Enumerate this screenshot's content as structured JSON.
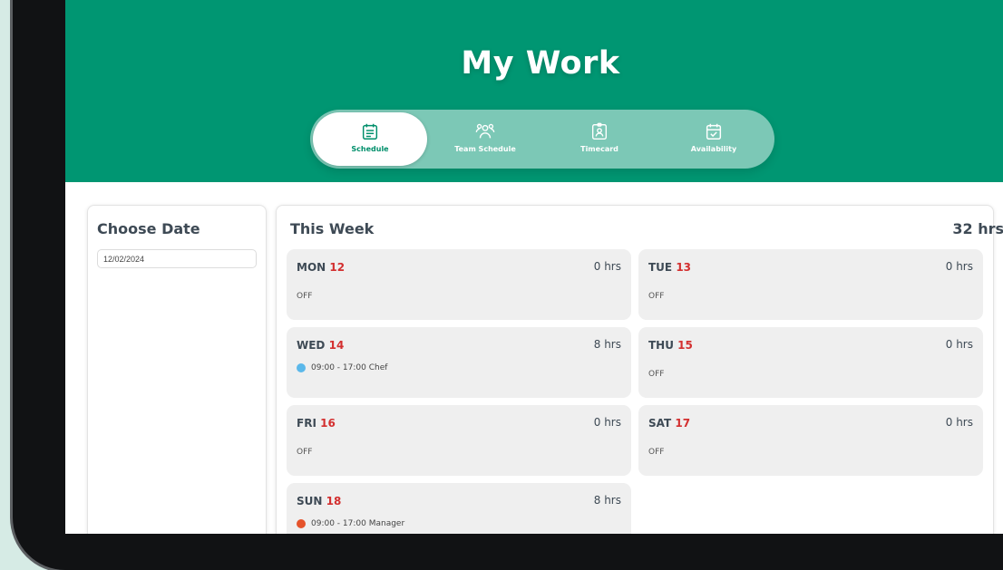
{
  "header": {
    "title": "My Work",
    "color": "#009672",
    "tabs": [
      {
        "label": "Schedule",
        "icon": "calendar-icon",
        "active": true
      },
      {
        "label": "Team Schedule",
        "icon": "team-icon",
        "active": false
      },
      {
        "label": "Timecard",
        "icon": "badge-icon",
        "active": false
      },
      {
        "label": "Availability",
        "icon": "calendar-check-icon",
        "active": false
      }
    ]
  },
  "date_picker": {
    "title": "Choose Date",
    "value": "12/02/2024"
  },
  "week": {
    "title": "This Week",
    "total": "32 hrs",
    "days": [
      {
        "name": "MON",
        "num": "12",
        "hours": "0 hrs",
        "status": "OFF"
      },
      {
        "name": "TUE",
        "num": "13",
        "hours": "0 hrs",
        "status": "OFF"
      },
      {
        "name": "WED",
        "num": "14",
        "hours": "8 hrs",
        "shift": "09:00 - 17:00 Chef",
        "shift_color": "#5bb8ea"
      },
      {
        "name": "THU",
        "num": "15",
        "hours": "0 hrs",
        "status": "OFF"
      },
      {
        "name": "FRI",
        "num": "16",
        "hours": "0 hrs",
        "status": "OFF"
      },
      {
        "name": "SAT",
        "num": "17",
        "hours": "0 hrs",
        "status": "OFF"
      },
      {
        "name": "SUN",
        "num": "18",
        "hours": "8 hrs",
        "shift": "09:00 - 17:00 Manager",
        "shift_color": "#e5532b"
      }
    ]
  }
}
